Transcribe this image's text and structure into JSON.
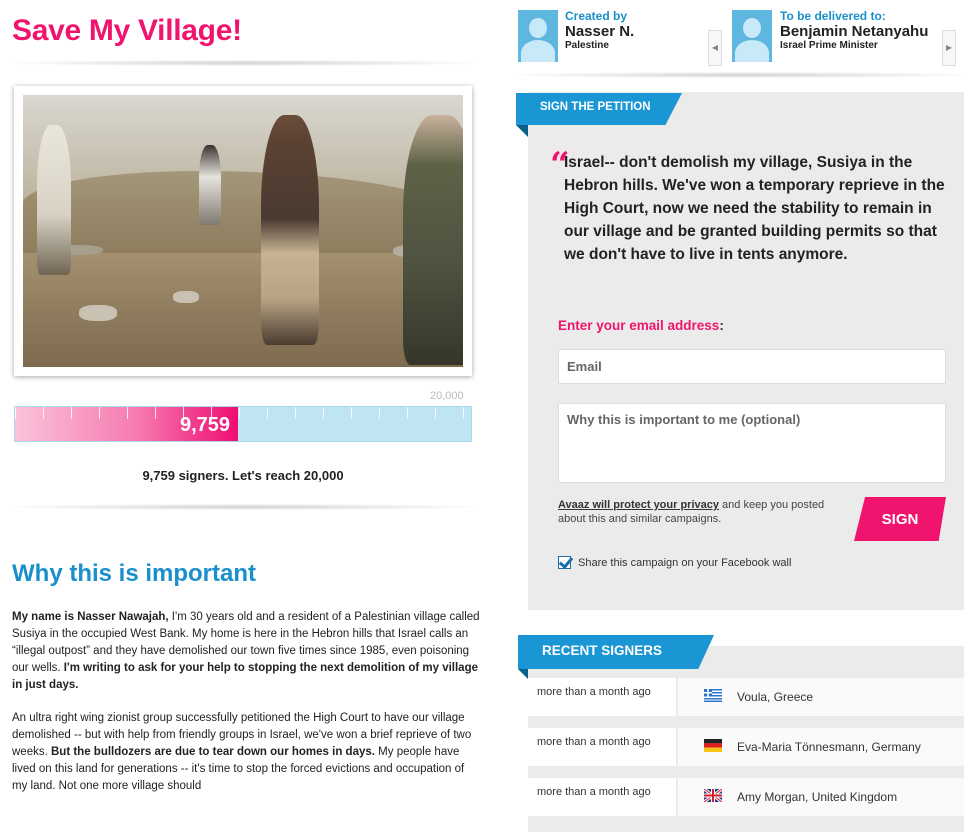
{
  "page": {
    "title": "Save My Village!"
  },
  "counter": {
    "current": 9759,
    "current_label": "9,759",
    "goal_label": "20,000",
    "progress_fraction": 0.488,
    "summary": "9,759 signers. Let's reach 20,000"
  },
  "why": {
    "title": "Why this is important",
    "p1_bold": "My name is Nasser Nawajah,",
    "p1_text": " I'm 30 years old and a resident of a Palestinian village called Susiya in the occupied West Bank. My home is here in the Hebron hills that Israel calls an “illegal outpost” and they have demolished our town five times since 1985, even poisoning our wells. ",
    "p1_bold2": "I'm writing to ask for your help to stopping the next demolition of my village in just days.",
    "p2_text": "An ultra right wing zionist group successfully petitioned the High Court to have our village demolished -- but with help from friendly groups in Israel, we've won a brief reprieve of two weeks. ",
    "p2_bold": "But the bulldozers are due to tear down our homes in days.",
    "p2_text2": " My people have lived on this land for generations -- it's time to stop the forced evictions and occupation of my land. Not one more village should"
  },
  "creator": {
    "label": "Created by",
    "name": "Nasser N.",
    "location": "Palestine"
  },
  "recipient": {
    "label": "To be delivered to:",
    "name": "Benjamin Netanyahu",
    "title": "Israel Prime Minister",
    "prev_icon": "caret-left-icon",
    "next_icon": "caret-right-icon"
  },
  "petition": {
    "tab_label": "SIGN THE PETITION",
    "quote_glyph": "“",
    "text": "Israel-- don't demolish my village, Susiya in the Hebron hills. We've won a temporary reprieve in the High Court, now we need the stability to remain in our village and be granted building permits so that we don't have to live in tents anymore.",
    "email_label": "Enter your email address",
    "email_label_suffix": ":",
    "email_placeholder": "Email",
    "why_placeholder": "Why this is important to me (optional)",
    "privacy_link": "Avaaz will protect your privacy",
    "privacy_text": " and keep you posted about this and similar campaigns.",
    "sign_label": "SIGN",
    "fb_share_label": "Share this campaign on your Facebook wall",
    "fb_share_checked": true
  },
  "recent": {
    "tab_label": "RECENT SIGNERS",
    "signers": [
      {
        "time": "more than a month ago",
        "name": "Voula",
        "country": ", Greece",
        "flag": "greece-flag-icon"
      },
      {
        "time": "more than a month ago",
        "name": "Eva-Maria Tönnesmann",
        "country": ", Germany",
        "flag": "germany-flag-icon"
      },
      {
        "time": "more than a month ago",
        "name": "Amy Morgan",
        "country": ", United Kingdom",
        "flag": "uk-flag-icon"
      }
    ]
  },
  "colors": {
    "brand_pink": "#f0146e",
    "brand_blue": "#1a8fcc",
    "progress_track": "#bfe4f2"
  }
}
